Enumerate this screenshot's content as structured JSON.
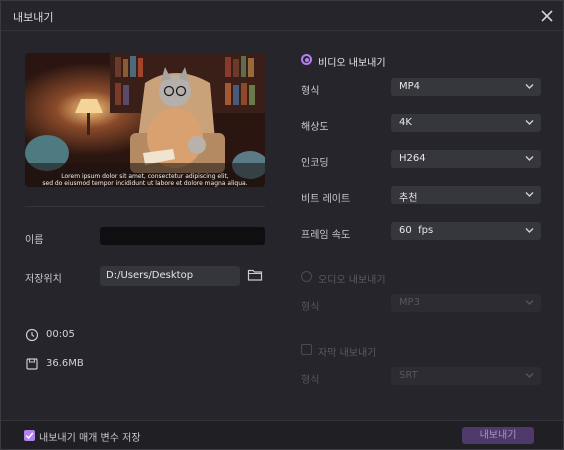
{
  "window": {
    "title": "내보내기"
  },
  "preview": {
    "subtitle_line1": "Lorem ipsum dolor sit amet, consectetur adipiscing elit,",
    "subtitle_line2": "sed do eiusmod tempor incididunt ut labore et dolore magna aliqua."
  },
  "left": {
    "name_label": "이름",
    "name_value": "",
    "location_label": "저장위치",
    "location_value": "D:/Users/Desktop",
    "duration": "00:05",
    "size": "36.6MB"
  },
  "video": {
    "header": "비디오 내보내기",
    "selected": true,
    "rows": [
      {
        "label": "형식",
        "value": "MP4"
      },
      {
        "label": "해상도",
        "value": "4K"
      },
      {
        "label": "인코딩",
        "value": "H264"
      },
      {
        "label": "비트 레이트",
        "value": "추천"
      },
      {
        "label": "프레임 속도",
        "value": "60  fps"
      }
    ]
  },
  "audio": {
    "header": "오디오 내보내기",
    "selected": false,
    "format_label": "형식",
    "format_value": "MP3"
  },
  "subtitles": {
    "header": "자막 내보내기",
    "checked": false,
    "format_label": "형식",
    "format_value": "SRT"
  },
  "footer": {
    "save_params_label": "내보내기 매개 변수 저장",
    "save_params_checked": true,
    "export_button": "내보내기"
  },
  "colors": {
    "accent": "#b480f0",
    "background": "#25252b",
    "export_button": "#4d3a6a"
  },
  "icons": [
    "close-icon",
    "folder-icon",
    "clock-icon",
    "disk-icon",
    "chevron-down-icon",
    "check-icon"
  ]
}
